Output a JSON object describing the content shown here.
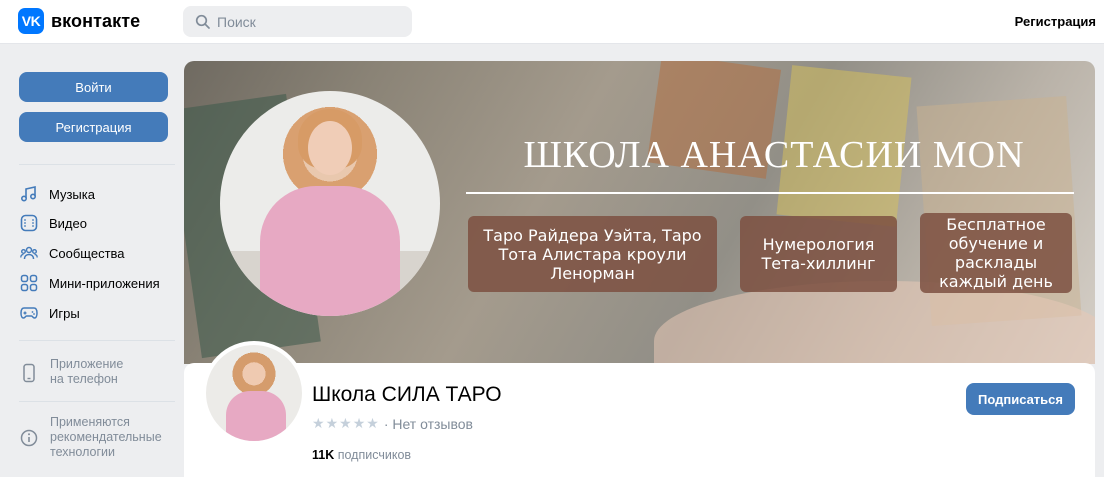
{
  "header": {
    "logo_mark": "VK",
    "logo_text": "вконтакте",
    "search_placeholder": "Поиск",
    "register": "Регистрация"
  },
  "sidebar": {
    "login": "Войти",
    "register": "Регистрация",
    "nav": [
      {
        "label": "Музыка",
        "icon": "music-icon"
      },
      {
        "label": "Видео",
        "icon": "video-icon"
      },
      {
        "label": "Сообщества",
        "icon": "communities-icon"
      },
      {
        "label": "Мини-приложения",
        "icon": "mini-apps-icon"
      },
      {
        "label": "Игры",
        "icon": "games-icon"
      }
    ],
    "app_phone": "Приложение на телефон",
    "recommendations": "Применяются рекомендательные технологии"
  },
  "cover": {
    "title": "ШКОЛА АНАСТАСИИ MON",
    "pills": [
      "Таро Райдера Уэйта, Таро Тота Алистара кроули Ленорман",
      "Нумерология Тета-хиллинг",
      "Бесплатное обучение и расклады каждый день"
    ]
  },
  "profile": {
    "name": "Школа СИЛА ТАРО",
    "rating_text": "· Нет отзывов",
    "subscribers_count": "11K",
    "subscribers_label": "подписчиков",
    "subscribe": "Подписаться"
  },
  "colors": {
    "accent": "#447bba",
    "brand": "#0077ff",
    "background": "#edeef0"
  }
}
